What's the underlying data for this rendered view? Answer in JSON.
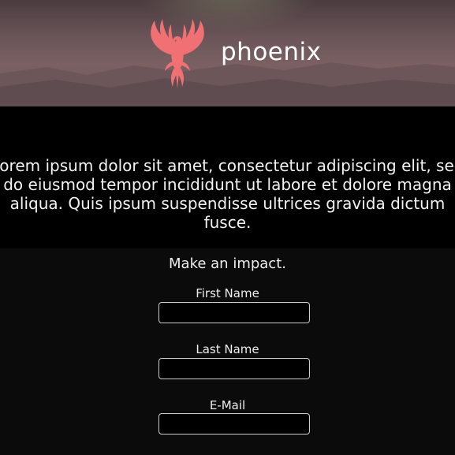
{
  "header": {
    "brand_name": "phoenix",
    "logo_icon": "phoenix-icon",
    "logo_color": "#f07074"
  },
  "hero": {
    "text": "Lorem ipsum dolor sit amet, consectetur adipiscing elit, sed do eiusmod tempor incididunt ut labore et dolore magna aliqua. Quis ipsum suspendisse ultrices gravida dictum fusce."
  },
  "form": {
    "tagline": "Make an impact.",
    "fields": [
      {
        "label": "First Name",
        "value": ""
      },
      {
        "label": "Last Name",
        "value": ""
      },
      {
        "label": "E-Mail",
        "value": ""
      }
    ]
  }
}
